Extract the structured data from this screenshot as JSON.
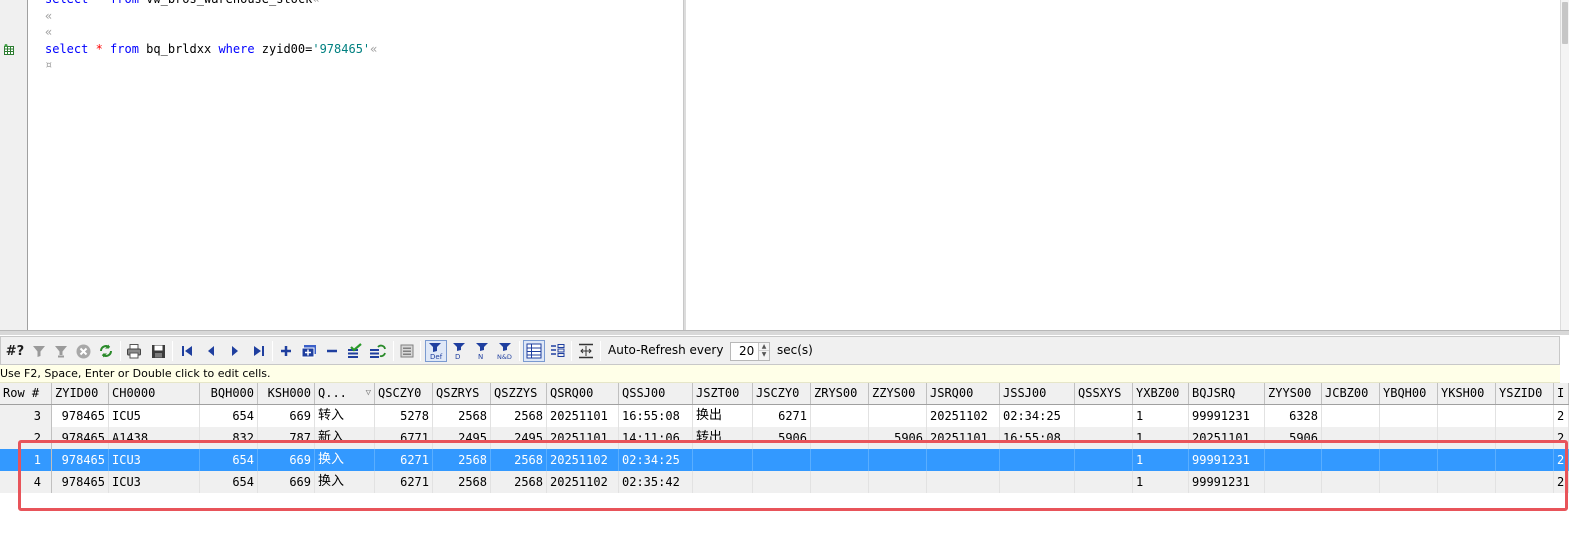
{
  "editor": {
    "lines": [
      [
        {
          "t": "select",
          "c": "kw"
        },
        {
          "t": " * ",
          "c": "star"
        },
        {
          "t": "from",
          "c": "kw"
        },
        {
          "t": " vw_bros_warehouse_stock",
          "c": ""
        },
        {
          "t": "«",
          "c": "nl"
        }
      ],
      [
        {
          "t": "«",
          "c": "nl"
        }
      ],
      [
        {
          "t": "«",
          "c": "nl"
        }
      ],
      [
        {
          "t": "select",
          "c": "kw"
        },
        {
          "t": " * ",
          "c": "star"
        },
        {
          "t": "from",
          "c": "kw"
        },
        {
          "t": " bq_brldxx ",
          "c": ""
        },
        {
          "t": "where",
          "c": "kw"
        },
        {
          "t": " zyid00=",
          "c": ""
        },
        {
          "t": "'978465'",
          "c": "str"
        },
        {
          "t": "«",
          "c": "nl"
        }
      ],
      [
        {
          "t": "¤",
          "c": "nl"
        }
      ]
    ]
  },
  "toolbar": {
    "record_count": "#?",
    "auto_refresh_label": "Auto-Refresh every",
    "refresh_interval": "20",
    "refresh_unit": "sec(s)",
    "buttons": [
      "filter-icon",
      "clear-filter-icon",
      "cancel-query-icon",
      "refresh-icon",
      "print-icon",
      "save-icon",
      "first-record-icon",
      "prior-record-icon",
      "next-record-icon",
      "last-record-icon",
      "insert-record-icon",
      "duplicate-record-icon",
      "delete-record-icon",
      "post-changes-icon",
      "refresh-records-icon",
      "single-record-view-icon",
      "default-view-icon",
      "descending-icon",
      "null-icon",
      "null-default-icon",
      "grid-view-icon",
      "form-view-icon",
      "column-width-icon"
    ]
  },
  "hint": "Use F2, Space, Enter or Double click to edit cells.",
  "grid": {
    "columns": [
      "Row #",
      "ZYID00",
      "CH0000",
      "BQH000",
      "KSH000",
      "Q...",
      "QSCZY0",
      "QSZRYS",
      "QSZZYS",
      "QSRQ00",
      "QSSJ00",
      "JSZT00",
      "JSCZY0",
      "ZRYS00",
      "ZZYS00",
      "JSRQ00",
      "JSSJ00",
      "QSSXYS",
      "YXBZ00",
      "BQJSRQ",
      "ZYYS00",
      "JCBZ00",
      "YBQH00",
      "YKSH00",
      "YSZID0",
      "I"
    ],
    "rows": [
      [
        "3",
        "978465",
        "ICU5",
        "654",
        "669",
        "转入",
        "5278",
        "2568",
        "2568",
        "20251101",
        "16:55:08",
        "换出",
        "6271",
        "",
        "",
        "20251102",
        "02:34:25",
        "",
        "1",
        "99991231",
        "6328",
        "",
        "",
        "",
        "",
        "2"
      ],
      [
        "2",
        "978465",
        "A1438",
        "832",
        "787",
        "新入",
        "6771",
        "2495",
        "2495",
        "20251101",
        "14:11:06",
        "转出",
        "5906",
        "",
        "5906",
        "20251101",
        "16:55:08",
        "",
        "1",
        "20251101",
        "5906",
        "",
        "",
        "",
        "",
        "2"
      ],
      [
        "1",
        "978465",
        "ICU3",
        "654",
        "669",
        "换入",
        "6271",
        "2568",
        "2568",
        "20251102",
        "02:34:25",
        "",
        "",
        "",
        "",
        "",
        "",
        "",
        "1",
        "99991231",
        "",
        "",
        "",
        "",
        "",
        "2"
      ],
      [
        "4",
        "978465",
        "ICU3",
        "654",
        "669",
        "换入",
        "6271",
        "2568",
        "2568",
        "20251102",
        "02:35:42",
        "",
        "",
        "",
        "",
        "",
        "",
        "",
        "1",
        "99991231",
        "",
        "",
        "",
        "",
        "",
        "2"
      ]
    ],
    "selected_row_index": 2
  },
  "colors": {
    "selection": "#3399ff",
    "keyword": "#0000ff",
    "string": "#008080",
    "highlight_box": "#e8545a"
  }
}
